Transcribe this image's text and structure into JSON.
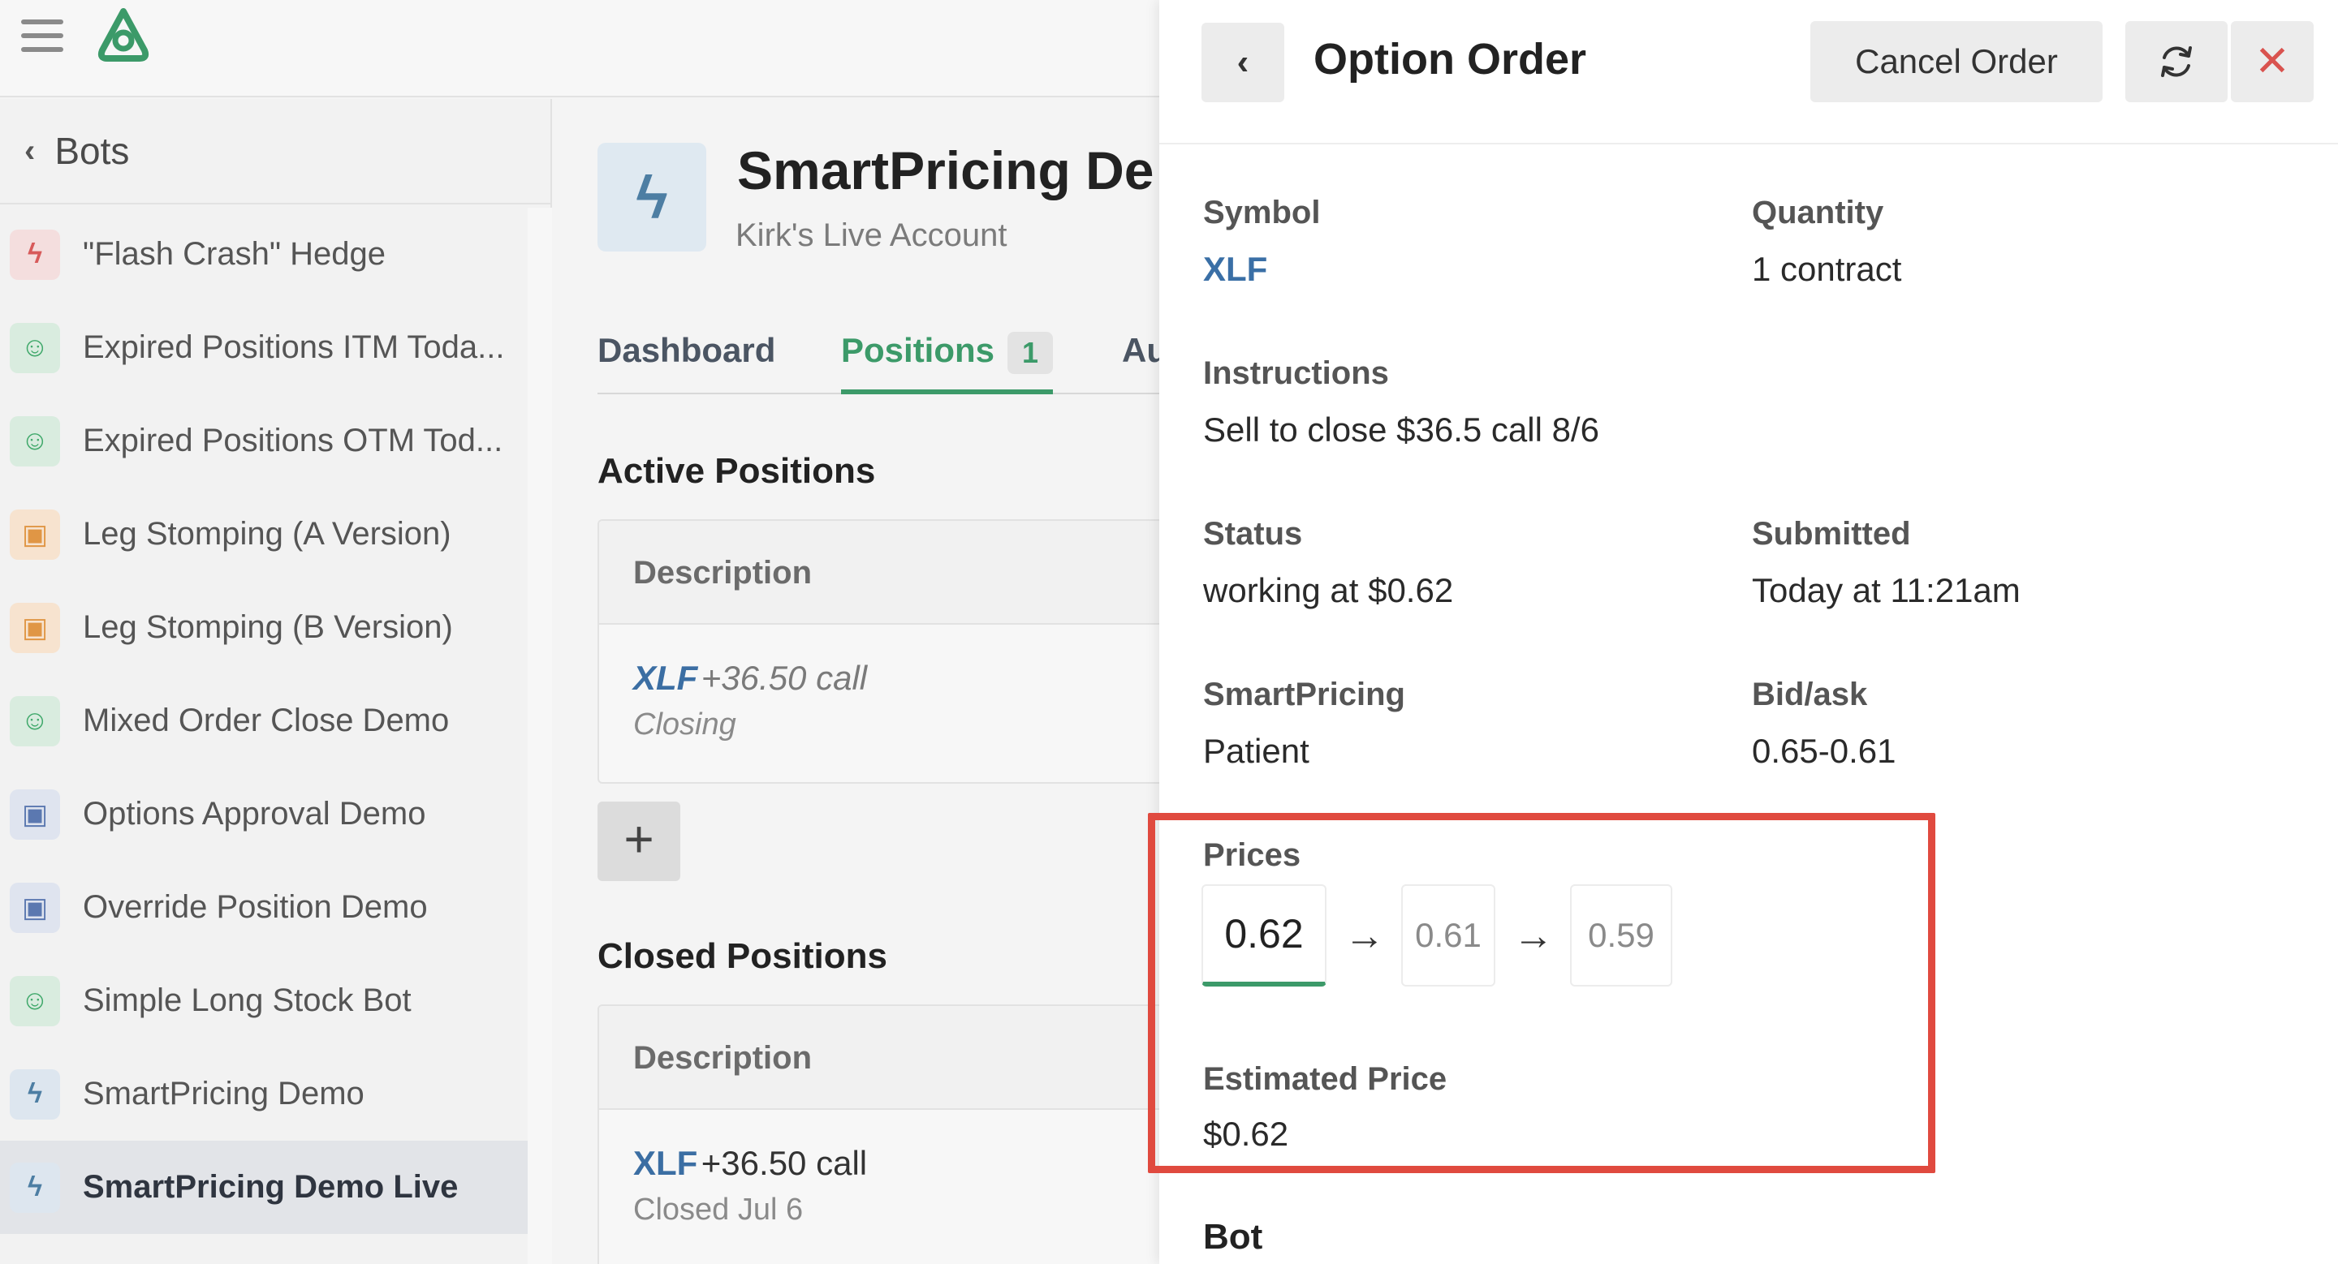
{
  "nav": {
    "back_label": "Bots"
  },
  "sidebar": {
    "items": [
      {
        "label": "\"Flash Crash\" Hedge",
        "icon": "flash-icon",
        "icon_glyph": "ϟ",
        "style": "ic-flash-red"
      },
      {
        "label": "Expired Positions ITM Toda...",
        "icon": "robot-face-icon",
        "icon_glyph": "☺",
        "style": "ic-green"
      },
      {
        "label": "Expired Positions OTM Tod...",
        "icon": "robot-face-icon",
        "icon_glyph": "☺",
        "style": "ic-green"
      },
      {
        "label": "Leg Stomping (A Version)",
        "icon": "robot-icon",
        "icon_glyph": "▣",
        "style": "ic-orange"
      },
      {
        "label": "Leg Stomping (B Version)",
        "icon": "robot-icon",
        "icon_glyph": "▣",
        "style": "ic-orange"
      },
      {
        "label": "Mixed Order Close Demo",
        "icon": "robot-face-icon",
        "icon_glyph": "☺",
        "style": "ic-green"
      },
      {
        "label": "Options Approval Demo",
        "icon": "robot-icon",
        "icon_glyph": "▣",
        "style": "ic-blue"
      },
      {
        "label": "Override Position Demo",
        "icon": "robot-icon",
        "icon_glyph": "▣",
        "style": "ic-blue"
      },
      {
        "label": "Simple Long Stock Bot",
        "icon": "robot-face-icon",
        "icon_glyph": "☺",
        "style": "ic-green"
      },
      {
        "label": "SmartPricing Demo",
        "icon": "flash-icon",
        "icon_glyph": "ϟ",
        "style": "ic-flash-blue"
      },
      {
        "label": "SmartPricing Demo Live",
        "icon": "flash-icon",
        "icon_glyph": "ϟ",
        "style": "ic-flash-blue",
        "active": true
      }
    ]
  },
  "bot": {
    "title": "SmartPricing De",
    "account": "Kirk's Live Account",
    "tabs": [
      {
        "label": "Dashboard"
      },
      {
        "label": "Positions",
        "count": "1"
      },
      {
        "label": "Au"
      }
    ]
  },
  "positions": {
    "active_title": "Active Positions",
    "closed_title": "Closed Positions",
    "column_header": "Description",
    "active_rows": [
      {
        "symbol": "XLF",
        "detail": "+36.50 call",
        "status": "Closing"
      }
    ],
    "closed_rows": [
      {
        "symbol": "XLF",
        "detail": "+36.50 call",
        "status": "Closed Jul 6"
      }
    ],
    "add_label": "+"
  },
  "drawer": {
    "title": "Option Order",
    "cancel_label": "Cancel Order",
    "close_glyph": "✕",
    "back_glyph": "‹",
    "fields": {
      "symbol_label": "Symbol",
      "symbol_value": "XLF",
      "quantity_label": "Quantity",
      "quantity_value": "1 contract",
      "instructions_label": "Instructions",
      "instructions_value": "Sell to close $36.5 call 8/6",
      "status_label": "Status",
      "status_value": "working at $0.62",
      "submitted_label": "Submitted",
      "submitted_value": "Today at 11:21am",
      "smartpricing_label": "SmartPricing",
      "smartpricing_value": "Patient",
      "bidask_label": "Bid/ask",
      "bidask_value": "0.65-0.61",
      "prices_label": "Prices",
      "prices": [
        "0.62",
        "0.61",
        "0.59"
      ],
      "arrow": "→",
      "estimated_label": "Estimated Price",
      "estimated_value": "$0.62",
      "bot_label": "Bot"
    }
  },
  "colors": {
    "accent_green": "#3c9a69",
    "link_blue": "#3a6fa6",
    "highlight_red": "#e04a3f"
  }
}
